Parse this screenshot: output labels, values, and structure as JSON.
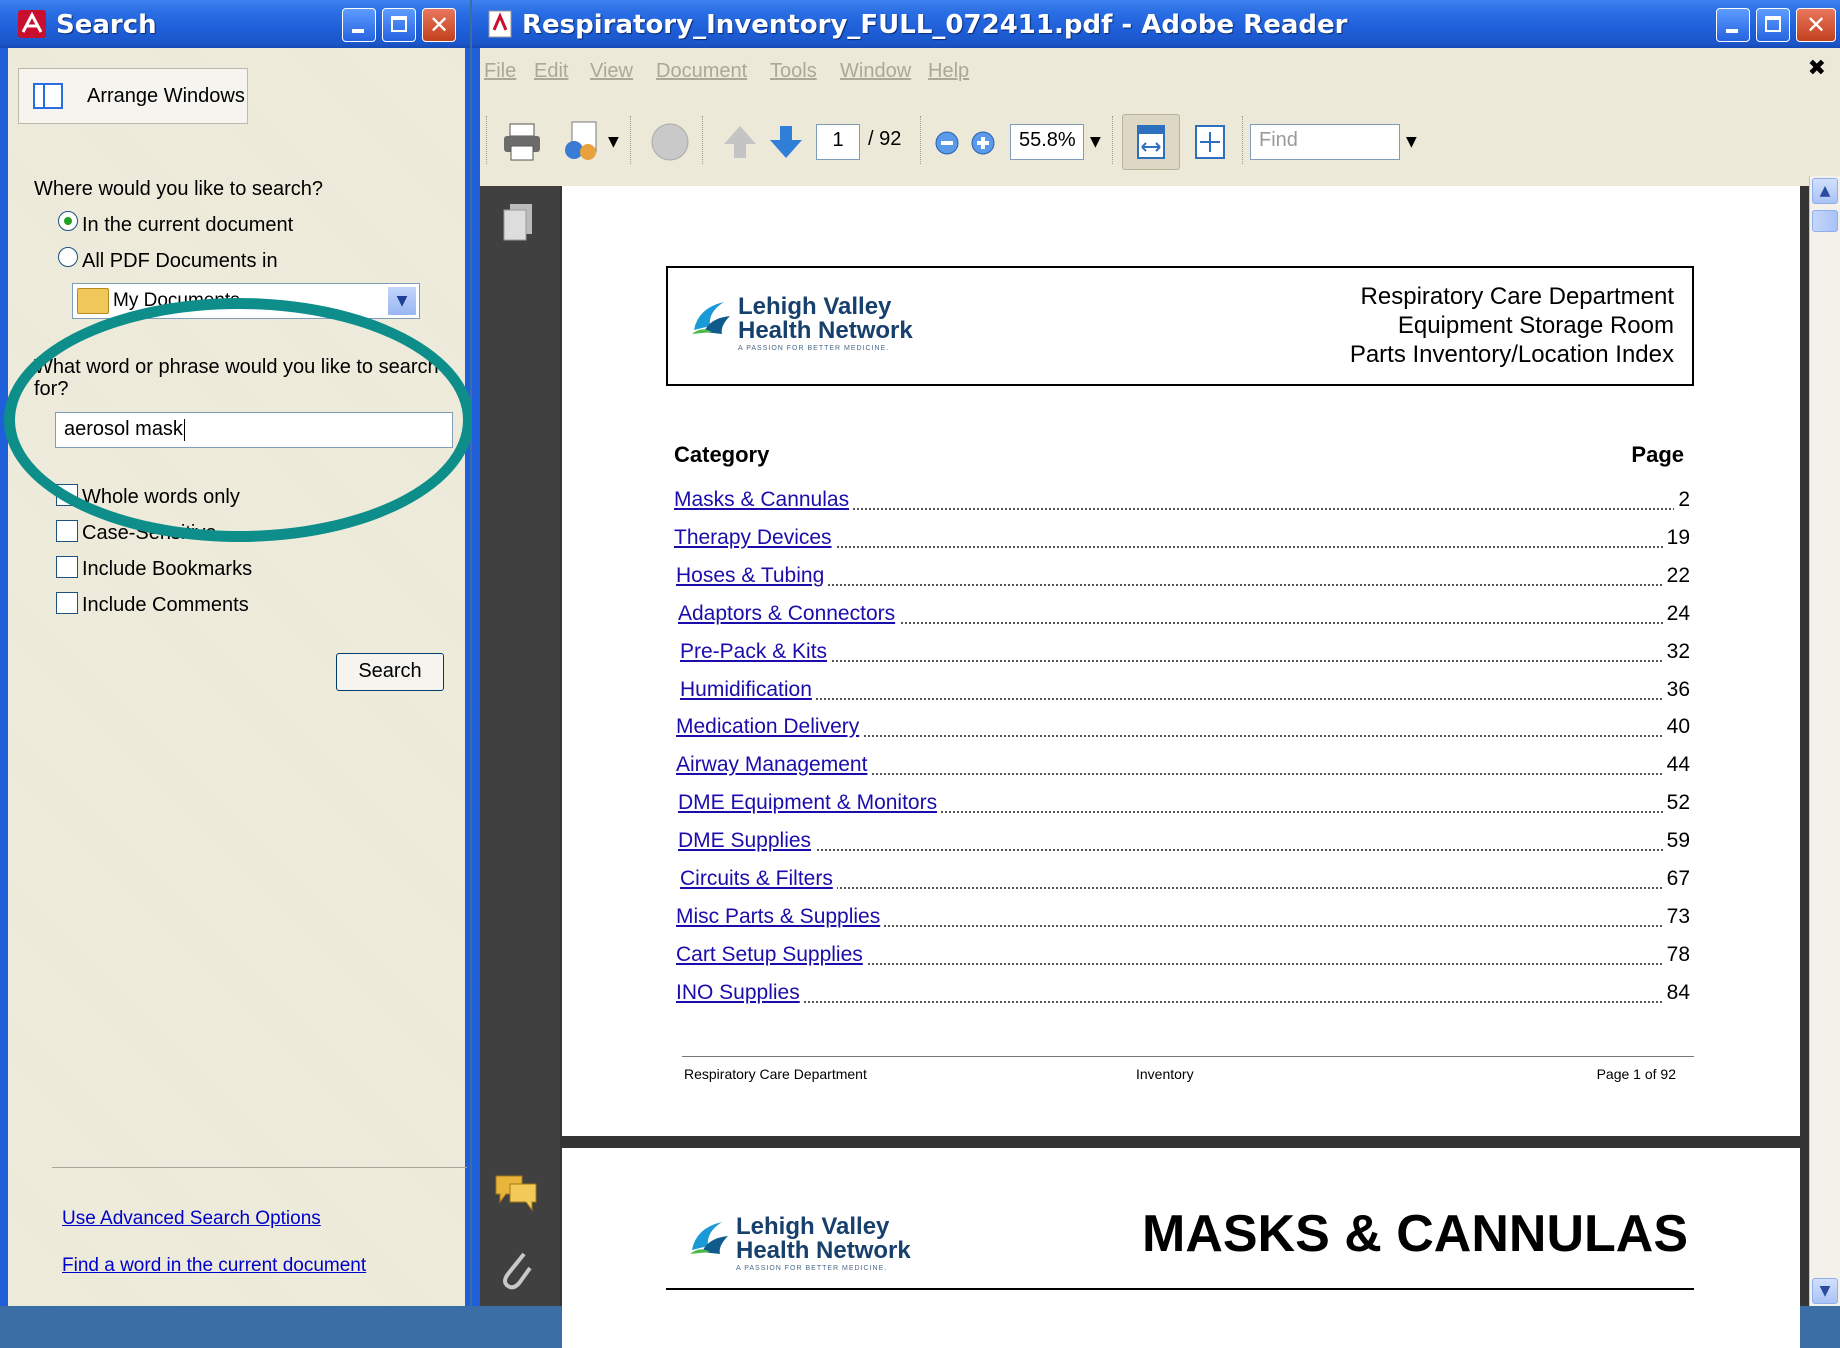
{
  "search_pane": {
    "title": "Search",
    "arrange_windows": "Arrange Windows",
    "where_label": "Where would you like to search?",
    "option_current": "In the current document",
    "option_all": "All PDF Documents in",
    "folder_select": "My Documents",
    "what_label_1": "What word or phrase would you like to search",
    "what_label_2": "for?",
    "query": "aerosol mask",
    "checkboxes": [
      "Whole words only",
      "Case-Sensitive",
      "Include Bookmarks",
      "Include Comments"
    ],
    "search_button": "Search",
    "advanced_link": "Use Advanced Search Options",
    "find_link": "Find a word in the current document",
    "highlight_color": "#0e8e8a"
  },
  "reader": {
    "title": "Respiratory_Inventory_FULL_072411.pdf - Adobe Reader",
    "menu": [
      "File",
      "Edit",
      "View",
      "Document",
      "Tools",
      "Window",
      "Help"
    ],
    "toolbar": {
      "page_number": "1",
      "page_total": "/ 92",
      "zoom": "55.8%",
      "find_placeholder": "Find"
    }
  },
  "document": {
    "logo_line1": "Lehigh Valley",
    "logo_line2": "Health Network",
    "logo_tagline": "A PASSION FOR BETTER MEDICINE.",
    "header_lines": [
      "Respiratory Care Department",
      "Equipment Storage Room",
      "Parts Inventory/Location Index"
    ],
    "col_category": "Category",
    "col_page": "Page",
    "toc": [
      {
        "category": "Masks & Cannulas",
        "page": "2"
      },
      {
        "category": "Therapy Devices",
        "page": "19"
      },
      {
        "category": "Hoses & Tubing",
        "page": "22"
      },
      {
        "category": "Adaptors & Connectors",
        "page": "24"
      },
      {
        "category": "Pre-Pack & Kits",
        "page": "32"
      },
      {
        "category": "Humidification",
        "page": "36"
      },
      {
        "category": "Medication Delivery",
        "page": "40"
      },
      {
        "category": "Airway Management",
        "page": "44"
      },
      {
        "category": "DME Equipment & Monitors",
        "page": "52"
      },
      {
        "category": "DME Supplies",
        "page": "59"
      },
      {
        "category": "Circuits & Filters",
        "page": "67"
      },
      {
        "category": "Misc Parts & Supplies",
        "page": "73"
      },
      {
        "category": "Cart Setup Supplies",
        "page": "78"
      },
      {
        "category": "INO Supplies",
        "page": "84"
      }
    ],
    "footer_left": "Respiratory Care Department",
    "footer_center": "Inventory",
    "footer_right": "Page 1 of 92",
    "page2_title": "MASKS & CANNULAS"
  }
}
